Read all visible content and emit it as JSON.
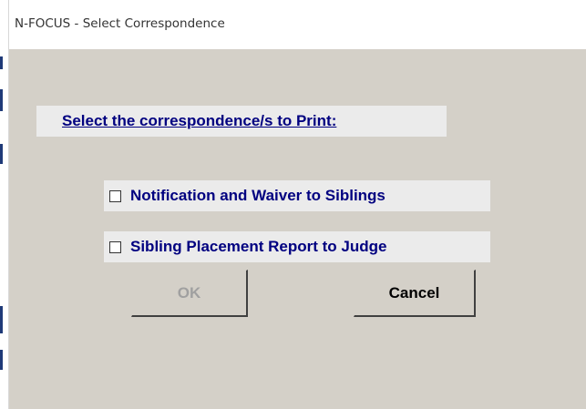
{
  "window": {
    "title": "N-FOCUS - Select Correspondence"
  },
  "dialog": {
    "prompt": "Select the correspondence/s to Print:",
    "options": [
      {
        "label": "Notification and Waiver to Siblings",
        "checked": false
      },
      {
        "label": "Sibling Placement Report to Judge",
        "checked": false
      }
    ],
    "buttons": {
      "ok_label": "OK",
      "ok_enabled": false,
      "cancel_label": "Cancel",
      "cancel_enabled": true
    }
  },
  "colors": {
    "dialog_background": "#d4d0c8",
    "panel_background": "#ebebeb",
    "label_text": "#000080",
    "disabled_text": "#a0a0a0"
  }
}
